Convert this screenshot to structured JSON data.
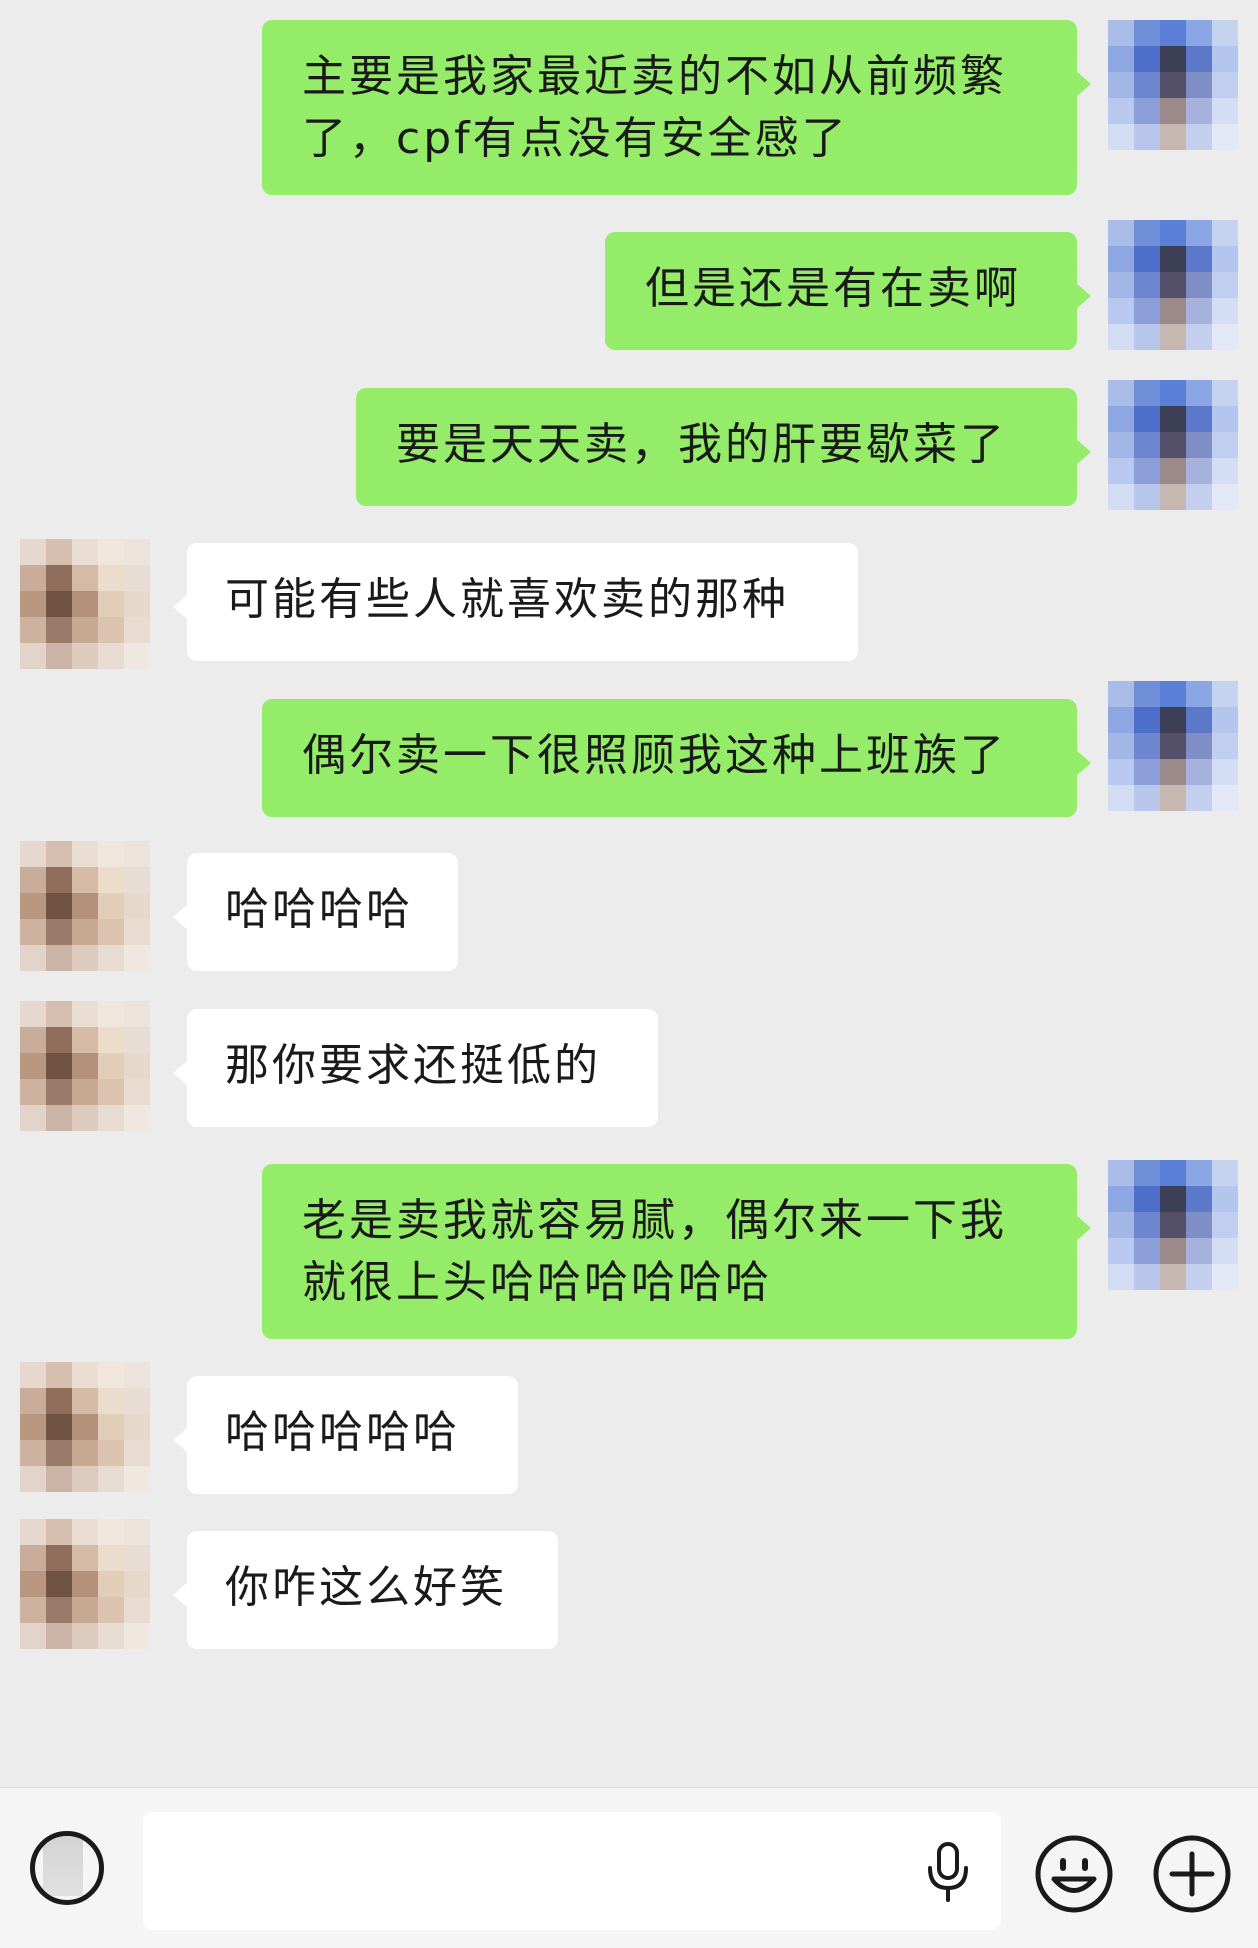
{
  "messages": [
    {
      "side": "self",
      "lines": [
        "主要是我家最近卖的不如从前频繁",
        "了，cpf有点没有安全感了"
      ]
    },
    {
      "side": "self",
      "lines": [
        "但是还是有在卖啊"
      ]
    },
    {
      "side": "self",
      "lines": [
        "要是天天卖，我的肝要歇菜了"
      ]
    },
    {
      "side": "peer",
      "lines": [
        "可能有些人就喜欢卖的那种"
      ]
    },
    {
      "side": "self",
      "lines": [
        "偶尔卖一下很照顾我这种上班族了"
      ]
    },
    {
      "side": "peer",
      "lines": [
        "哈哈哈哈"
      ]
    },
    {
      "side": "peer",
      "lines": [
        "那你要求还挺低的"
      ]
    },
    {
      "side": "self",
      "lines": [
        "老是卖我就容易腻，偶尔来一下我",
        "就很上头哈哈哈哈哈哈"
      ]
    },
    {
      "side": "peer",
      "lines": [
        "哈哈哈哈哈"
      ]
    },
    {
      "side": "peer",
      "lines": [
        "你咋这么好笑"
      ]
    }
  ],
  "input_bar": {
    "text_value": "",
    "icons": {
      "voice_toggle": "voice-mode-icon",
      "mic": "microphone-icon",
      "emoji": "smiley-icon",
      "plus": "plus-icon"
    }
  },
  "colors": {
    "background": "#ececec",
    "self_bubble": "#95ec69",
    "peer_bubble": "#ffffff",
    "text": "#1a1a1a",
    "input_bar": "#f5f5f5"
  }
}
